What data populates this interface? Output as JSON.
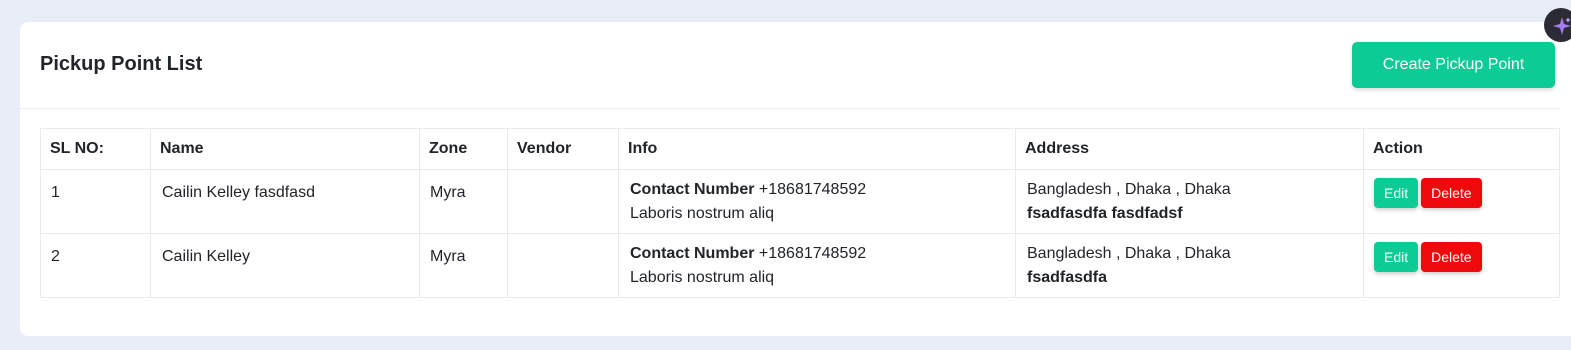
{
  "header": {
    "title": "Pickup Point List",
    "create_label": "Create Pickup Point"
  },
  "table": {
    "columns": [
      "SL NO:",
      "Name",
      "Zone",
      "Vendor",
      "Info",
      "Address",
      "Action"
    ],
    "rows": [
      {
        "sl": "1",
        "name": "Cailin Kelley fasdfasd",
        "zone": "Myra",
        "vendor": "",
        "contact_label": "Contact Number",
        "contact_number": "+18681748592",
        "info_note": "Laboris nostrum aliq",
        "address_line1": "Bangladesh , Dhaka , Dhaka",
        "address_line2": "fsadfasdfa fasdfadsf",
        "edit_label": "Edit",
        "delete_label": "Delete"
      },
      {
        "sl": "2",
        "name": "Cailin Kelley",
        "zone": "Myra",
        "vendor": "",
        "contact_label": "Contact Number",
        "contact_number": "+18681748592",
        "info_note": "Laboris nostrum aliq",
        "address_line1": "Bangladesh , Dhaka , Dhaka",
        "address_line2": "fsadfasdfa",
        "edit_label": "Edit",
        "delete_label": "Delete"
      }
    ]
  },
  "colors": {
    "accent": "#0dcb94",
    "danger": "#ee0a0a",
    "page_bg": "#e9edf7"
  },
  "icons": {
    "assistant": "sparkle-icon"
  }
}
